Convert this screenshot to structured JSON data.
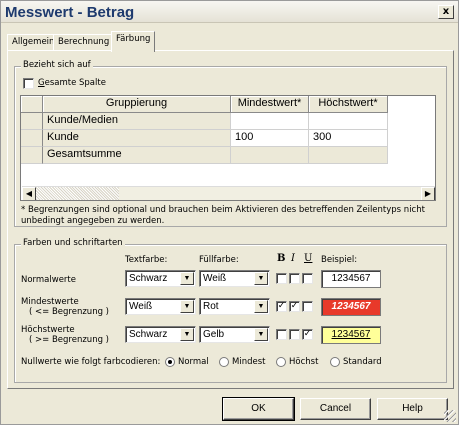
{
  "window": {
    "title": "Messwert - Betrag",
    "close": "x"
  },
  "tabs": [
    {
      "label": "Allgemein"
    },
    {
      "label": "Berechnung"
    },
    {
      "label": "Färbung"
    }
  ],
  "applies": {
    "legend": "Bezieht sich auf",
    "whole_column": {
      "label": "Gesamte Spalte",
      "checked": false
    },
    "table": {
      "headers": [
        "Gruppierung",
        "Mindestwert*",
        "Höchstwert*"
      ],
      "rows": [
        {
          "group": "Kunde/Medien",
          "min": "",
          "max": ""
        },
        {
          "group": "Kunde",
          "min": "100",
          "max": "300"
        },
        {
          "group": "Gesamtsumme",
          "min": "",
          "max": ""
        }
      ]
    },
    "note": "* Begrenzungen sind optional und brauchen beim Aktivieren des betreffenden Zeilentyps nicht unbedingt angegeben zu werden."
  },
  "colors": {
    "legend": "Farben und schriftarten",
    "headers": {
      "text": "Textfarbe:",
      "fill": "Füllfarbe:",
      "bold": "B",
      "italic": "I",
      "underline": "U",
      "example": "Beispiel:"
    },
    "rows": [
      {
        "label1": "Normalwerte",
        "label2": "",
        "text": "Schwarz",
        "fill": "Weiß",
        "bold": false,
        "italic": false,
        "underline": false,
        "sample": "1234567",
        "sample_bg": "#ffffff",
        "sample_fg": "#000000"
      },
      {
        "label1": "Mindestwerte",
        "label2": "( <= Begrenzung )",
        "text": "Weiß",
        "fill": "Rot",
        "bold": true,
        "italic": true,
        "underline": false,
        "sample": "1234567",
        "sample_bg": "#e8392a",
        "sample_fg": "#ffffff"
      },
      {
        "label1": "Höchstwerte",
        "label2": "( >= Begrenzung )",
        "text": "Schwarz",
        "fill": "Gelb",
        "bold": false,
        "italic": false,
        "underline": true,
        "sample": "1234567",
        "sample_bg": "#ffff99",
        "sample_fg": "#000000"
      }
    ],
    "null_label": "Nullwerte wie folgt farbcodieren:",
    "null_options": [
      {
        "label": "Normal",
        "selected": true
      },
      {
        "label": "Mindest",
        "selected": false
      },
      {
        "label": "Höchst",
        "selected": false
      },
      {
        "label": "Standard",
        "selected": false
      }
    ]
  },
  "buttons": {
    "ok": "OK",
    "cancel": "Cancel",
    "help": "Help"
  }
}
